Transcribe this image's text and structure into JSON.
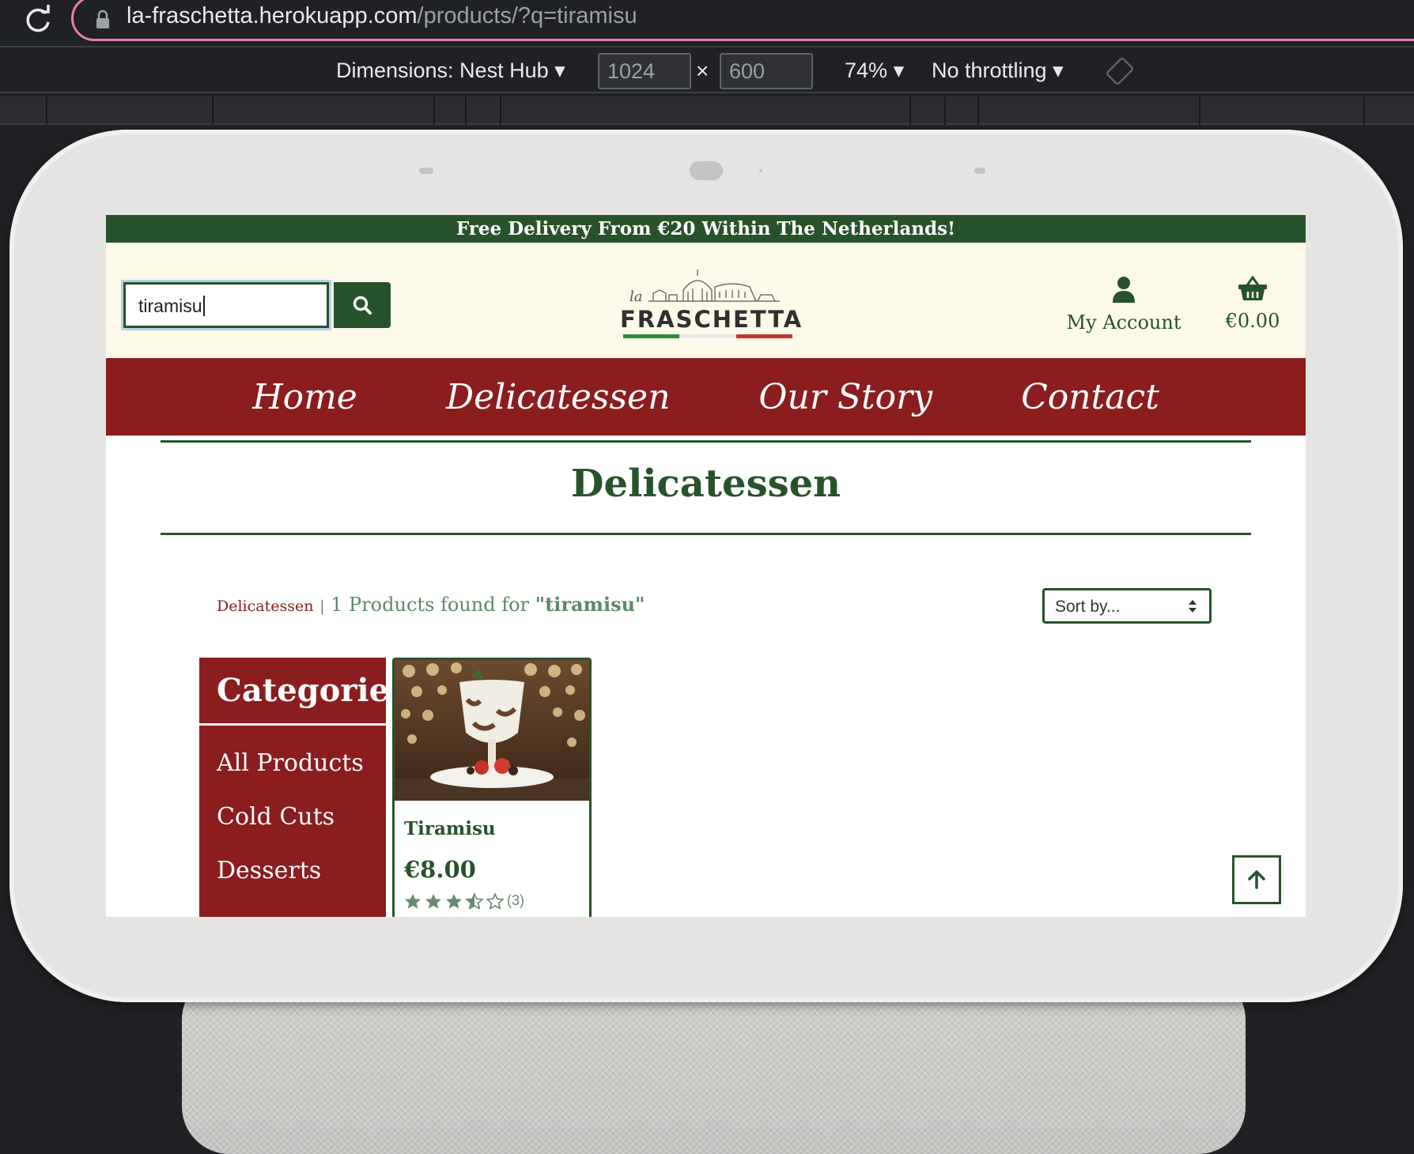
{
  "browser": {
    "url_host": "la-fraschetta.herokuapp.com",
    "url_path": "/products/?q=tiramisu",
    "device_label": "Dimensions: Nest Hub",
    "width": "1024",
    "height": "600",
    "zoom": "74%",
    "throttling": "No throttling",
    "times": "×"
  },
  "site": {
    "promo": "Free Delivery From €20 Within The Netherlands!",
    "search_value": "tiramisu",
    "logo_word": "FRASCHETTA",
    "logo_script": "la",
    "account_label": "My Account",
    "cart_total": "€0.00",
    "nav": [
      "Home",
      "Delicatessen",
      "Our Story",
      "Contact"
    ],
    "page_title": "Delicatessen",
    "breadcrumb": "Delicatessen",
    "breadcrumb_sep": "|",
    "results_prefix": "1 Products found for ",
    "results_query": "\"tiramisu\"",
    "sort_placeholder": "Sort by...",
    "categories_title": "Categories",
    "categories": [
      "All Products",
      "Cold Cuts",
      "Desserts"
    ],
    "product": {
      "name": "Tiramisu",
      "price": "€8.00",
      "rating": 3.5,
      "rating_count": "(3)"
    }
  },
  "colors": {
    "green": "#27532a",
    "red": "#8b1d1e",
    "cream": "#fdf9e8",
    "url_highlight": "#e87bb8"
  },
  "icons": [
    "reload-icon",
    "lock-icon",
    "dropdown-triangle-icon",
    "rotate-icon",
    "search-icon",
    "user-icon",
    "basket-icon",
    "star-icon",
    "arrow-up-icon"
  ]
}
